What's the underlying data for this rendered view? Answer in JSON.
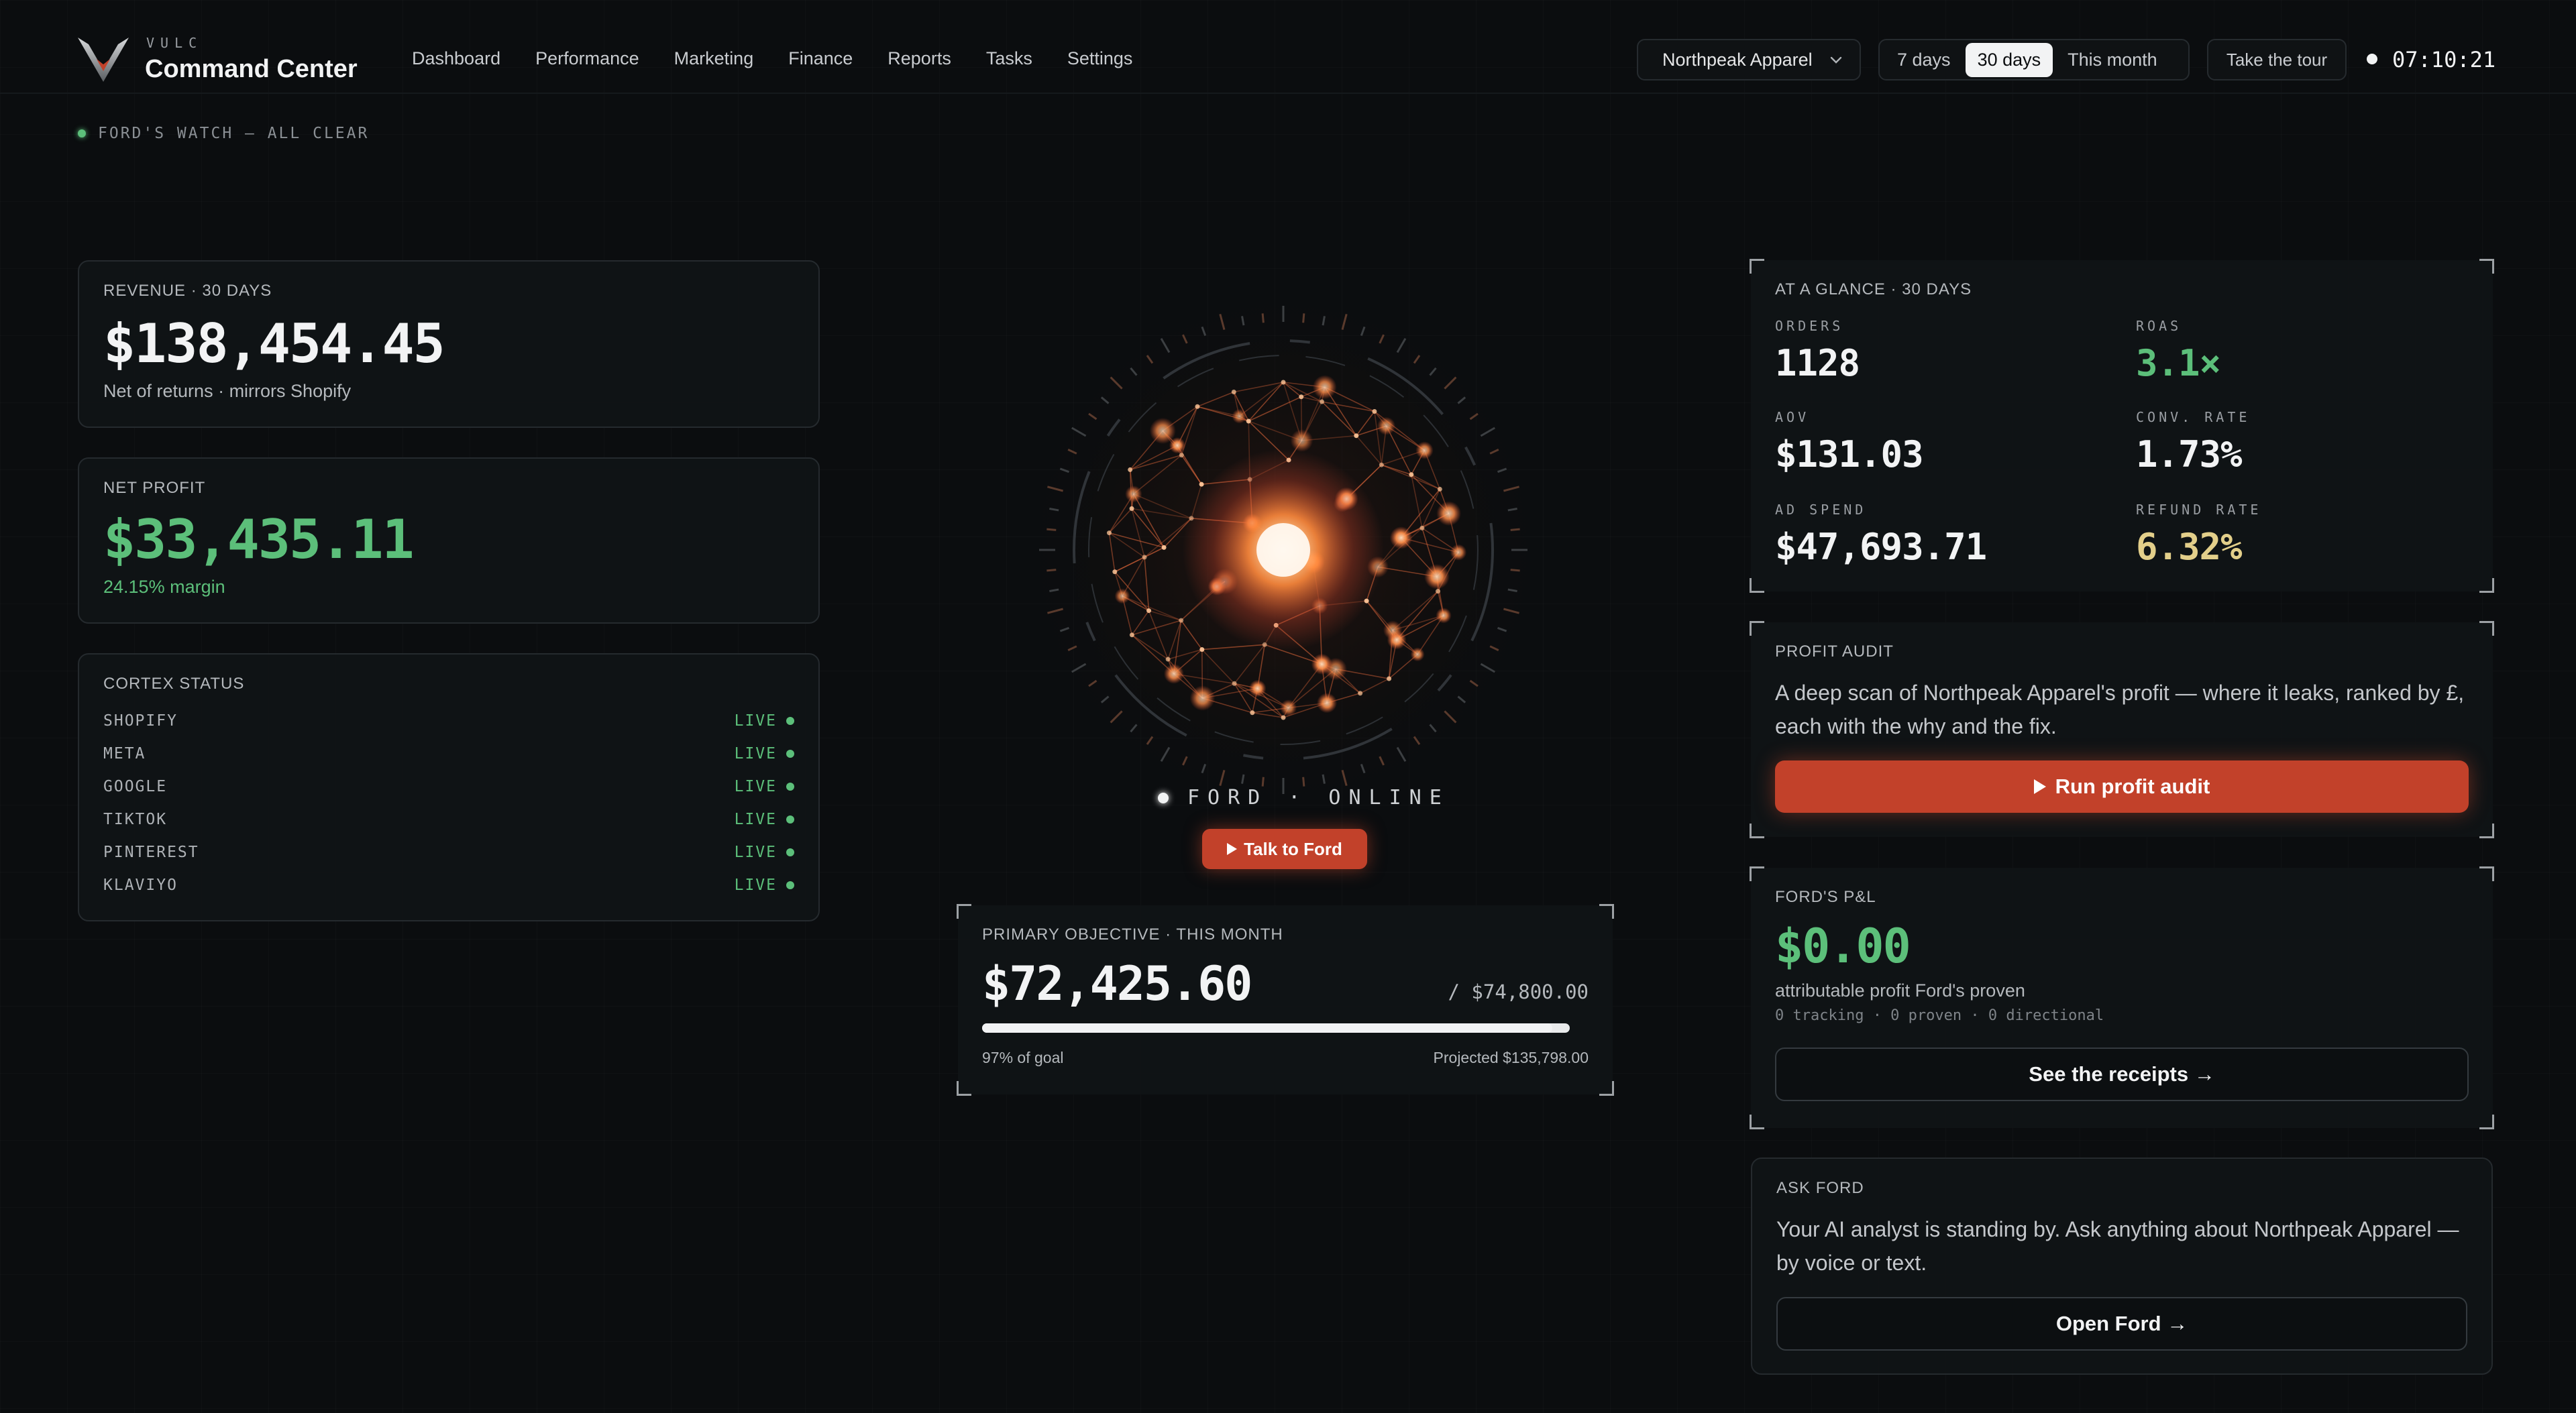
{
  "brand": {
    "small": "VULC",
    "title": "Command Center"
  },
  "nav": [
    "Dashboard",
    "Performance",
    "Marketing",
    "Finance",
    "Reports",
    "Tasks",
    "Settings"
  ],
  "store": {
    "selected": "Northpeak Apparel"
  },
  "range": {
    "options": [
      "7 days",
      "30 days",
      "This month"
    ],
    "active": "30 days"
  },
  "tour_label": "Take the tour",
  "clock": "07:10:21",
  "watch": "FORD'S WATCH — ALL CLEAR",
  "revenue": {
    "label": "REVENUE · 30 DAYS",
    "value": "$138,454.45",
    "note": "Net of returns · mirrors Shopify"
  },
  "net_profit": {
    "label": "NET PROFIT",
    "value": "$33,435.11",
    "note": "24.15% margin"
  },
  "cortex": {
    "label": "CORTEX STATUS",
    "items": [
      {
        "name": "SHOPIFY",
        "status": "LIVE"
      },
      {
        "name": "META",
        "status": "LIVE"
      },
      {
        "name": "GOOGLE",
        "status": "LIVE"
      },
      {
        "name": "TIKTOK",
        "status": "LIVE"
      },
      {
        "name": "PINTEREST",
        "status": "LIVE"
      },
      {
        "name": "KLAVIYO",
        "status": "LIVE"
      }
    ]
  },
  "ford": {
    "status": "FORD · ONLINE",
    "talk_label": "Talk to Ford"
  },
  "objective": {
    "label": "PRIMARY OBJECTIVE · THIS MONTH",
    "value": "$72,425.60",
    "goal": "/ $74,800.00",
    "progress": 0.97,
    "percent_text": "97% of goal",
    "projected": "Projected $135,798.00"
  },
  "glance": {
    "label": "AT A GLANCE · 30 DAYS",
    "metrics": [
      {
        "label": "ORDERS",
        "value": "1128",
        "color": "#f2f3f4"
      },
      {
        "label": "ROAS",
        "value": "3.1×",
        "color": "#5cbf7a"
      },
      {
        "label": "AOV",
        "value": "$131.03",
        "color": "#f2f3f4"
      },
      {
        "label": "CONV. RATE",
        "value": "1.73%",
        "color": "#f2f3f4"
      },
      {
        "label": "AD SPEND",
        "value": "$47,693.71",
        "color": "#f2f3f4"
      },
      {
        "label": "REFUND RATE",
        "value": "6.32%",
        "color": "#e3cf8a"
      }
    ]
  },
  "audit": {
    "label": "PROFIT AUDIT",
    "text": "A deep scan of Northpeak Apparel's profit — where it leaks, ranked by £, each with the why and the fix.",
    "button": "Run profit audit"
  },
  "pnl": {
    "label": "FORD'S P&L",
    "value": "$0.00",
    "caption": "attributable profit Ford's proven",
    "detail": "0 tracking · 0 proven · 0 directional",
    "button": "See the receipts →"
  },
  "ask": {
    "label": "ASK FORD",
    "text": "Your AI analyst is standing by. Ask anything about Northpeak Apparel — by voice or text.",
    "button": "Open Ford →"
  },
  "colors": {
    "accent": "#c2412a",
    "positive": "#5cbf7a",
    "warning": "#e3cf8a"
  }
}
